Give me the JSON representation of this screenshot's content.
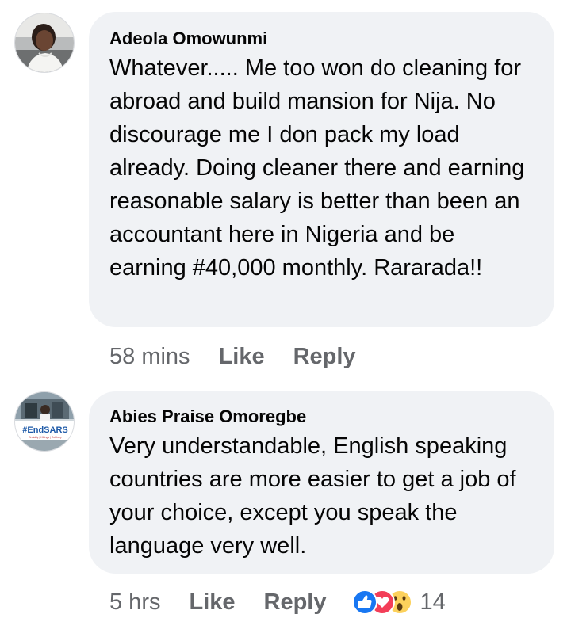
{
  "comments": [
    {
      "author": "Adeola Omowunmi",
      "text": "Whatever..... Me too won do cleaning for abroad and build mansion for Nija. No discourage me I don pack my load already. Doing cleaner there and earning reasonable salary is better than been an accountant here in Nigeria and be earning #40,000 monthly. Rararada!!",
      "time": "58 mins",
      "like_label": "Like",
      "reply_label": "Reply"
    },
    {
      "author": "Abies Praise Omoregbe",
      "text": "Very understandable, English speaking countries are more easier to get a job of your choice, except you speak the language very well.",
      "time": "5 hrs",
      "like_label": "Like",
      "reply_label": "Reply",
      "reactions": {
        "icons": [
          "like-reaction-icon",
          "love-reaction-icon",
          "wow-reaction-icon"
        ],
        "count": "14"
      },
      "avatar_overlay": {
        "hashtag": "#EndSARS",
        "tagline": "Brutality | Killings | Robbery"
      }
    }
  ],
  "colors": {
    "bubble": "#f0f2f5",
    "meta_text": "#65676b",
    "like_blue": "#1877f2",
    "love_red": "#f33e58",
    "wow_yellow": "#fcd15c",
    "endsars_blue": "#1e5aa8"
  }
}
